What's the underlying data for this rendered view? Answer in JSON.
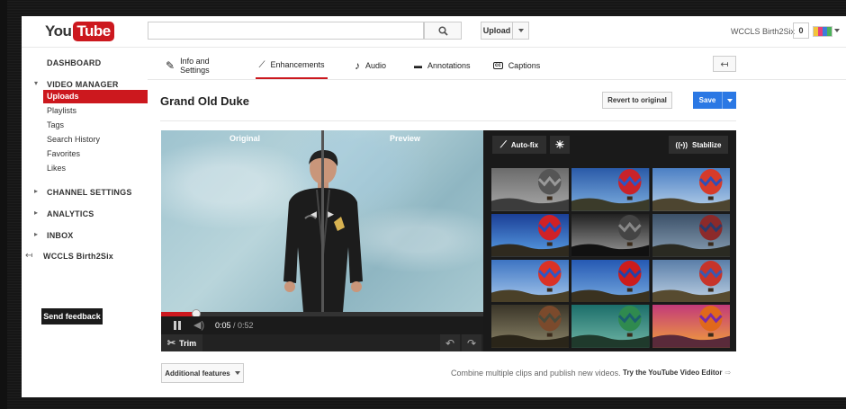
{
  "header": {
    "logo_you": "You",
    "logo_tube": "Tube",
    "search_placeholder": "",
    "upload_label": "Upload",
    "username": "WCCLS Birth2Six",
    "notifications": "0"
  },
  "sidebar": {
    "dashboard": "DASHBOARD",
    "video_manager": "VIDEO MANAGER",
    "sub_items": [
      "Uploads",
      "Playlists",
      "Tags",
      "Search History",
      "Favorites",
      "Likes"
    ],
    "active_sub": "Uploads",
    "channel_settings": "CHANNEL SETTINGS",
    "analytics": "ANALYTICS",
    "inbox": "INBOX",
    "channel_name": "WCCLS Birth2Six",
    "feedback": "Send feedback"
  },
  "tabs": [
    {
      "label": "Info and Settings",
      "icon": "pencil-icon"
    },
    {
      "label": "Enhancements",
      "icon": "magic-wand-icon",
      "active": true
    },
    {
      "label": "Audio",
      "icon": "music-note-icon"
    },
    {
      "label": "Annotations",
      "icon": "speech-bubble-icon"
    },
    {
      "label": "Captions",
      "icon": "captions-icon"
    }
  ],
  "video": {
    "title": "Grand Old Duke",
    "revert_label": "Revert to original",
    "save_label": "Save",
    "original_label": "Original",
    "preview_label": "Preview",
    "current_time": "0:05",
    "duration": "/ 0:52",
    "progress": 0.11,
    "trim_label": "Trim"
  },
  "filters": {
    "autofix_label": "Auto-fix",
    "stabilize_label": "Stabilize",
    "stabilize_icon_text": "((•))"
  },
  "footer": {
    "additional_label": "Additional features",
    "combine_text": "Combine multiple clips and publish new videos.",
    "editor_link": "Try the YouTube Video Editor"
  },
  "colors": {
    "brand_red": "#cc181e",
    "save_blue": "#2b78e4"
  }
}
